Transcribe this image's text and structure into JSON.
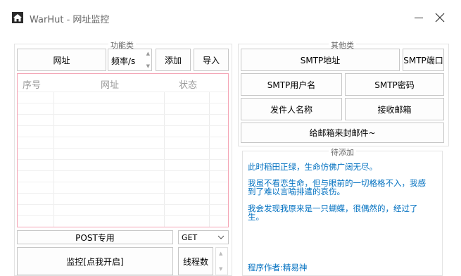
{
  "window": {
    "app_name": "WarHut",
    "title": "WarHut - 网址监控",
    "logo_icon": "house-icon",
    "minimize_icon": "minimize-icon",
    "close_icon": "close-icon"
  },
  "function_group": {
    "title": "功能类",
    "url_button": "网址",
    "frequency_field": "频率/s",
    "add_button": "添加",
    "import_button": "导入",
    "table_headers": [
      "序号",
      "网址",
      "状态"
    ],
    "post_button": "POST专用",
    "method_select": "GET",
    "monitor_button": "监控[点我开启]",
    "thread_button": "线程数"
  },
  "other_group": {
    "title": "其他类",
    "smtp_address_button": "SMTP地址",
    "smtp_port_button": "SMTP端口",
    "smtp_user_button": "SMTP用户名",
    "smtp_password_button": "SMTP密码",
    "sender_name_button": "发件人名称",
    "receiver_email_button": "接收邮箱",
    "send_test_button": "给邮箱来封邮件~"
  },
  "pending_group": {
    "title": "待添加",
    "lines": [
      "此时稻田正绿，生命仿佛广阔无尽。",
      "我虽不看恋生命，但与眼前的一切格格不入，我感",
      "到了难以言喻排遣的哀伤。",
      "我会发现我原来是一只蝴蝶，很偶然的，经过了",
      "生。",
      "程序作者:精易神"
    ]
  },
  "colors": {
    "table_border": "#f4a6b6",
    "log_text": "#0070c0"
  }
}
